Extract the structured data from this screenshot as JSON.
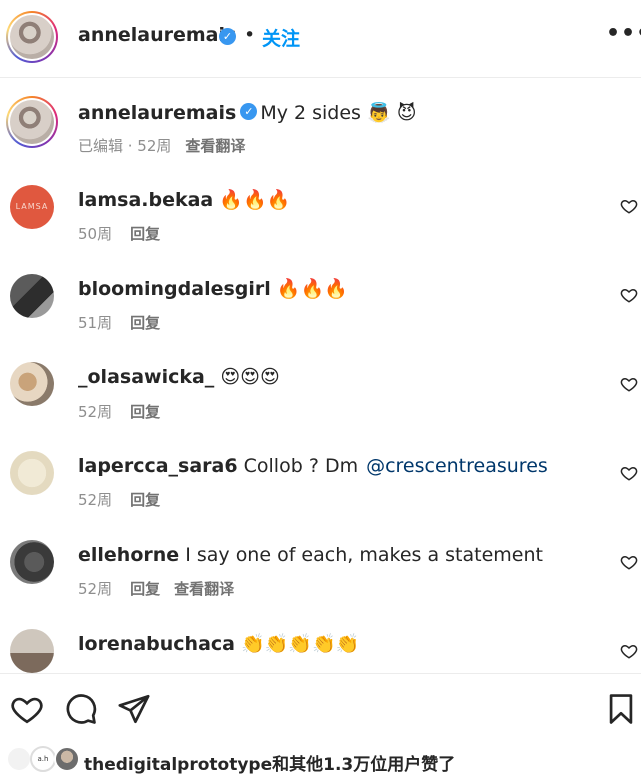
{
  "header": {
    "username": "annelauremais",
    "verified_mark": "✓",
    "separator": "•",
    "follow_label": "关注",
    "more_label": "•••"
  },
  "caption": {
    "username": "annelauremais",
    "verified_mark": "✓",
    "text": "My 2 sides 👼 😈",
    "meta": "已编辑 · 52周",
    "translate_label": "查看翻译"
  },
  "comments": [
    {
      "username": "lamsa.bekaa",
      "text": "🔥🔥🔥",
      "mention": "",
      "time": "50周",
      "reply_label": "回复",
      "translate_label": "",
      "avatar_text": "LAMSA"
    },
    {
      "username": "bloomingdalesgirl",
      "text": "🔥🔥🔥",
      "mention": "",
      "time": "51周",
      "reply_label": "回复",
      "translate_label": ""
    },
    {
      "username": "_olasawicka_",
      "text": "😍😍😍",
      "mention": "",
      "time": "52周",
      "reply_label": "回复",
      "translate_label": ""
    },
    {
      "username": "lapercca_sara6",
      "text": "Collob ? Dm",
      "mention": "@crescentreasures",
      "time": "52周",
      "reply_label": "回复",
      "translate_label": ""
    },
    {
      "username": "ellehorne",
      "text": "I say one of each, makes a statement",
      "mention": "",
      "time": "52周",
      "reply_label": "回复",
      "translate_label": "查看翻译"
    },
    {
      "username": "lorenabuchaca",
      "text": "👏👏👏👏👏",
      "mention": "",
      "time": "",
      "reply_label": "",
      "translate_label": ""
    }
  ],
  "likes": {
    "text": "thedigitalprototype和其他1.3万位用户赞了",
    "mini_avatar_1": "",
    "mini_avatar_2": "a.h"
  },
  "colors": {
    "link_blue": "#0095f6",
    "verified_blue": "#3897f0",
    "mention_blue": "#00376b",
    "meta_gray": "#8e8e8e"
  },
  "icons": [
    "more-icon",
    "verified-icon",
    "heart-icon",
    "comment-icon",
    "share-icon",
    "bookmark-icon"
  ]
}
